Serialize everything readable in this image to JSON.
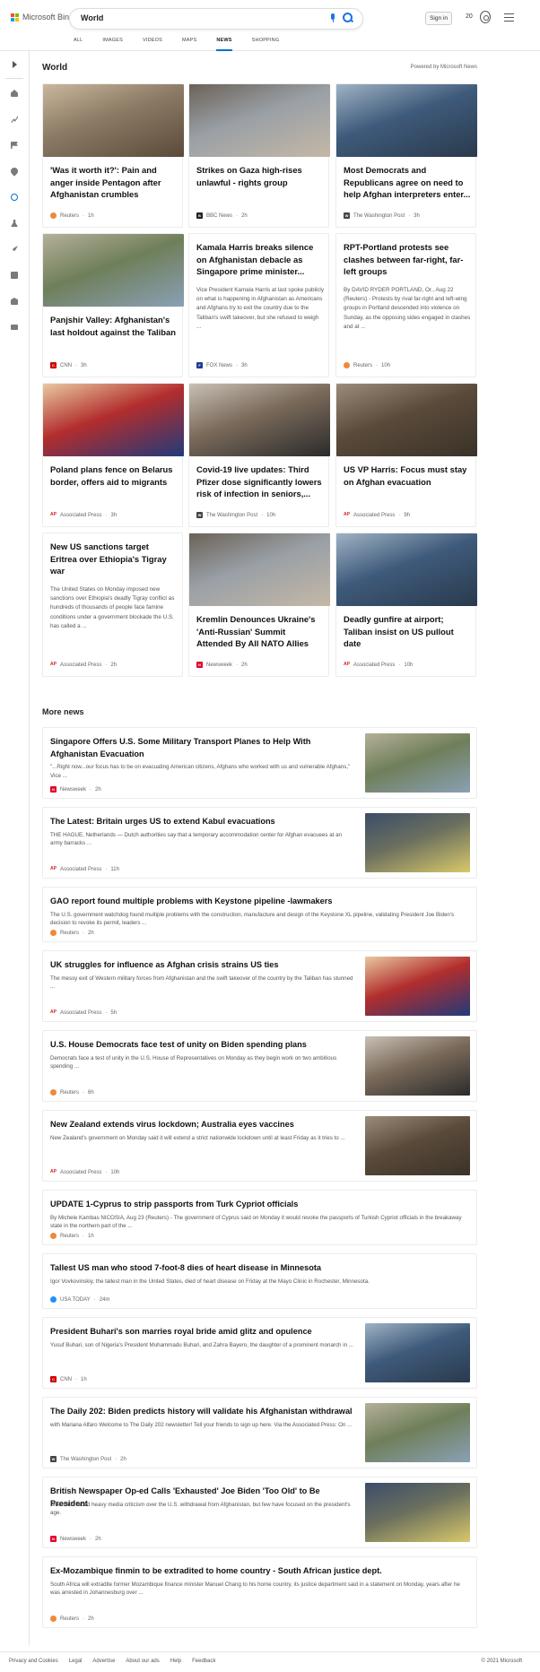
{
  "header": {
    "logo_text": "Microsoft Bing",
    "search_query": "World",
    "sign_in": "Sign in",
    "rewards_points": "20",
    "scopes": [
      "ALL",
      "IMAGES",
      "VIDEOS",
      "MAPS",
      "NEWS",
      "SHOPPING"
    ],
    "active_scope": "NEWS"
  },
  "section": {
    "title": "World",
    "powered_by": "Powered by Microsoft News"
  },
  "cards": [
    {
      "title": "'Was it worth it?': Pain and anger inside Pentagon after Afghanistan crumbles",
      "description": "",
      "source": "Reuters",
      "time": "1h",
      "logo": "reuters-logo",
      "has_image": true
    },
    {
      "title": "Strikes on Gaza high-rises unlawful - rights group",
      "description": "",
      "source": "BBC News",
      "time": "2h",
      "logo": "bbc-logo",
      "has_image": true
    },
    {
      "title": "Most Democrats and Republicans agree on need to help Afghan interpreters enter...",
      "description": "",
      "source": "The Washington Post",
      "time": "3h",
      "logo": "wapo-logo",
      "has_image": true
    },
    {
      "title": "Panjshir Valley: Afghanistan's last holdout against the Taliban",
      "description": "",
      "source": "CNN",
      "time": "3h",
      "logo": "cnn-logo",
      "has_image": true
    },
    {
      "title": "Kamala Harris breaks silence on Afghanistan debacle as Singapore prime minister...",
      "description": "Vice President Kamala Harris at last spoke publicly on what is happening in Afghanistan as Americans and Afghans try to exit the country due to the Taliban's swift takeover, but she refused to weigh ...",
      "source": "FOX News",
      "time": "3h",
      "logo": "fox-logo",
      "has_image": false
    },
    {
      "title": "RPT-Portland protests see clashes between far-right, far-left groups",
      "description": "By DAVID RYDER PORTLAND, Or., Aug 22 (Reuters) - Protests by rival far-right and left-wing groups in Portland descended into violence on Sunday, as the opposing sides engaged in clashes and at ...",
      "source": "Reuters",
      "time": "10h",
      "logo": "reuters-logo",
      "has_image": false
    },
    {
      "title": "Poland plans fence on Belarus border, offers aid to migrants",
      "description": "",
      "source": "Associated Press",
      "time": "3h",
      "logo": "ap-logo",
      "has_image": true
    },
    {
      "title": "Covid-19 live updates: Third Pfizer dose significantly lowers risk of infection in seniors,...",
      "description": "",
      "source": "The Washington Post",
      "time": "10h",
      "logo": "wapo-logo",
      "has_image": true
    },
    {
      "title": "US VP Harris: Focus must stay on Afghan evacuation",
      "description": "",
      "source": "Associated Press",
      "time": "9h",
      "logo": "ap-logo",
      "has_image": true
    },
    {
      "title": "New US sanctions target Eritrea over Ethiopia's Tigray war",
      "description": "The United States on Monday imposed new sanctions over Ethiopia's deadly Tigray conflict as hundreds of thousands of people face famine conditions under a government blockade the U.S. has called a ...",
      "source": "Associated Press",
      "time": "2h",
      "logo": "ap-logo",
      "has_image": false
    },
    {
      "title": "Kremlin Denounces Ukraine's 'Anti-Russian' Summit Attended By All NATO Allies",
      "description": "",
      "source": "Newsweek",
      "time": "2h",
      "logo": "newsweek-logo",
      "has_image": true
    },
    {
      "title": "Deadly gunfire at airport; Taliban insist on US pullout date",
      "description": "",
      "source": "Associated Press",
      "time": "10h",
      "logo": "ap-logo",
      "has_image": true
    }
  ],
  "more_news": {
    "title": "More news",
    "items": [
      {
        "title": "Singapore Offers U.S. Some Military Transport Planes to Help With Afghanistan Evacuation",
        "description": "\"...Right now...our focus has to be on evacuating American citizens, Afghans who worked with us and vulnerable Afghans,\" Vice ...",
        "source": "Newsweek",
        "time": "2h",
        "logo": "newsweek-logo",
        "has_image": true
      },
      {
        "title": "The Latest: Britain urges US to extend Kabul evacuations",
        "description": "THE HAGUE, Netherlands — Dutch authorities say that a temporary accommodation center for Afghan evacuees at an army barracks ...",
        "source": "Associated Press",
        "time": "11h",
        "logo": "ap-logo",
        "has_image": true
      },
      {
        "title": "GAO report found multiple problems with Keystone pipeline -lawmakers",
        "description": "The U.S. government watchdog found multiple problems with the construction, manufacture and design of the Keystone XL pipeline, validating President Joe Biden's decision to revoke its permit, leaders ...",
        "source": "Reuters",
        "time": "2h",
        "logo": "reuters-logo",
        "has_image": false
      },
      {
        "title": "UK struggles for influence as Afghan crisis strains US ties",
        "description": "The messy exit of Western military forces from Afghanistan and the swift takeover of the country by the Taliban has stunned ...",
        "source": "Associated Press",
        "time": "5h",
        "logo": "ap-logo",
        "has_image": true
      },
      {
        "title": "U.S. House Democrats face test of unity on Biden spending plans",
        "description": "Democrats face a test of unity in the U.S. House of Representatives on Monday as they begin work on two ambitious spending ...",
        "source": "Reuters",
        "time": "6h",
        "logo": "reuters-logo",
        "has_image": true
      },
      {
        "title": "New Zealand extends virus lockdown; Australia eyes vaccines",
        "description": "New Zealand's government on Monday said it will extend a strict nationwide lockdown until at least Friday as it tries to ...",
        "source": "Associated Press",
        "time": "10h",
        "logo": "ap-logo",
        "has_image": true
      },
      {
        "title": "UPDATE 1-Cyprus to strip passports from Turk Cypriot officials",
        "description": "By Michele Kambas NICOSIA, Aug 23 (Reuters) - The government of Cyprus said on Monday it would revoke the passports of Turkish Cypriot officials in the breakaway state in the northern part of the ...",
        "source": "Reuters",
        "time": "1h",
        "logo": "reuters-logo",
        "has_image": false
      },
      {
        "title": "Tallest US man who stood 7-foot-8 dies of heart disease in Minnesota",
        "description": "Igor Vovkovinskiy, the tallest man in the United States, died of heart disease on Friday at the Mayo Clinic in Rochester, Minnesota.",
        "source": "USA TODAY",
        "time": "24m",
        "logo": "usatoday-logo",
        "has_image": false
      },
      {
        "title": "President Buhari's son marries royal bride amid glitz and opulence",
        "description": "Yusuf Buhari, son of Nigeria's President Muhammadu Buhari, and Zahra Bayero, the daughter of a prominent monarch in ...",
        "source": "CNN",
        "time": "1h",
        "logo": "cnn-logo",
        "has_image": true
      },
      {
        "title": "The Daily 202: Biden predicts history will validate his Afghanistan withdrawal",
        "description": "with Mariana Alfaro Welcome to The Daily 202 newsletter! Tell your friends to sign up here. Via the Associated Press: On ...",
        "source": "The Washington Post",
        "time": "2h",
        "logo": "wapo-logo",
        "has_image": true
      },
      {
        "title": "British Newspaper Op-ed Calls 'Exhausted' Joe Biden 'Too Old' to Be President",
        "description": "Biden has faced heavy media criticism over the U.S. withdrawal from Afghanistan, but few have focused on the president's age.",
        "source": "Newsweek",
        "time": "2h",
        "logo": "newsweek-logo",
        "has_image": true
      },
      {
        "title": "Ex-Mozambique finmin to be extradited to home country - South African justice dept.",
        "description": "South Africa will extradite former Mozambique finance minister Manuel Chang to his home country, its justice department said in a statement on Monday, years after he was arrested in Johannesburg over ...",
        "source": "Reuters",
        "time": "2h",
        "logo": "reuters-logo",
        "has_image": false
      }
    ]
  },
  "footer": {
    "links": [
      "Privacy and Cookies",
      "Legal",
      "Advertise",
      "About our ads",
      "Help",
      "Feedback"
    ],
    "copyright": "© 2021 Microsoft"
  },
  "colors": {
    "accent": "#0a6ed1",
    "reuters": "#f0883a",
    "cnn": "#cc0000",
    "ap": "#d21f26",
    "newsweek": "#e4002b",
    "usatoday": "#1e90ff",
    "wapo": "#444444",
    "fox": "#1f3a93",
    "bbc": "#222222"
  }
}
